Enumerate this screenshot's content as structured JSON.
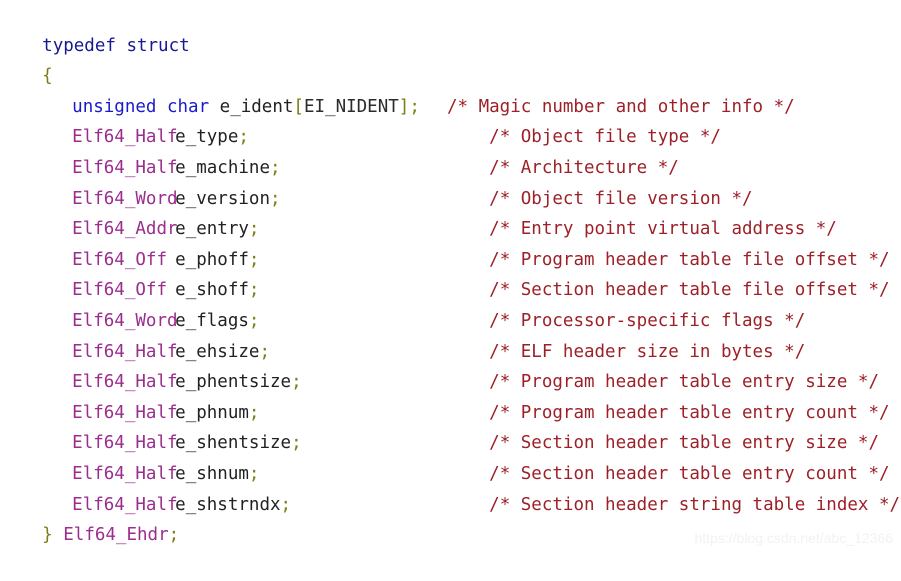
{
  "code": {
    "language": "C",
    "title": "Elf64_Ehdr structure definition",
    "background_color": "#ffffff",
    "colors": {
      "keyword": "#1a1acc",
      "typedef": "#181892",
      "type": "#9b2d8f",
      "identifier": "#222222",
      "punctuation": "#7d7d16",
      "brace": "#7d7d16",
      "comment": "#9d2028",
      "watermark": "#f2f2f2"
    },
    "lines": [
      {
        "id": "line-typedef",
        "indent": "",
        "keyword": "typedef struct",
        "type": "",
        "name": "",
        "semicolon": "",
        "comment": ""
      },
      {
        "id": "line-open-brace",
        "indent": "",
        "brace": "{",
        "comment": ""
      },
      {
        "id": "line-e-ident",
        "indent": "  ",
        "keyword": "unsigned char",
        "name": " e_ident",
        "bracket_open": "[",
        "constant": "EI_NIDENT",
        "bracket_close": "]",
        "semicolon": ";",
        "comment": "/* Magic number and other info */"
      },
      {
        "id": "line-e-type",
        "type": "Elf64_Half",
        "name": "e_type",
        "semicolon": ";",
        "comment": "/* Object file type */"
      },
      {
        "id": "line-e-machine",
        "type": "Elf64_Half",
        "name": "e_machine",
        "semicolon": ";",
        "comment": "/* Architecture */"
      },
      {
        "id": "line-e-version",
        "type": "Elf64_Word",
        "name": "e_version",
        "semicolon": ";",
        "comment": "/* Object file version */"
      },
      {
        "id": "line-e-entry",
        "type": "Elf64_Addr",
        "name": "e_entry",
        "semicolon": ";",
        "comment": "/* Entry point virtual address */"
      },
      {
        "id": "line-e-phoff",
        "type": "Elf64_Off",
        "name": "e_phoff",
        "semicolon": ";",
        "comment": "/* Program header table file offset */"
      },
      {
        "id": "line-e-shoff",
        "type": "Elf64_Off",
        "name": "e_shoff",
        "semicolon": ";",
        "comment": "/* Section header table file offset */"
      },
      {
        "id": "line-e-flags",
        "type": "Elf64_Word",
        "name": "e_flags",
        "semicolon": ";",
        "comment": "/* Processor-specific flags */"
      },
      {
        "id": "line-e-ehsize",
        "type": "Elf64_Half",
        "name": "e_ehsize",
        "semicolon": ";",
        "comment": "/* ELF header size in bytes */"
      },
      {
        "id": "line-e-phentsize",
        "type": "Elf64_Half",
        "name": "e_phentsize",
        "semicolon": ";",
        "comment": "/* Program header table entry size */"
      },
      {
        "id": "line-e-phnum",
        "type": "Elf64_Half",
        "name": "e_phnum",
        "semicolon": ";",
        "comment": "/* Program header table entry count */"
      },
      {
        "id": "line-e-shentsize",
        "type": "Elf64_Half",
        "name": "e_shentsize",
        "semicolon": ";",
        "comment": "/* Section header table entry size */"
      },
      {
        "id": "line-e-shnum",
        "type": "Elf64_Half",
        "name": "e_shnum",
        "semicolon": ";",
        "comment": "/* Section header table entry count */"
      },
      {
        "id": "line-e-shstrndx",
        "type": "Elf64_Half",
        "name": "e_shstrndx",
        "semicolon": ";",
        "comment": "/* Section header string table index */"
      },
      {
        "id": "line-close-brace",
        "brace": "}",
        "type": "Elf64_Ehdr",
        "semicolon": ";",
        "comment": ""
      }
    ]
  },
  "watermark": {
    "text": "https://blog.csdn.net/abc_12366"
  }
}
